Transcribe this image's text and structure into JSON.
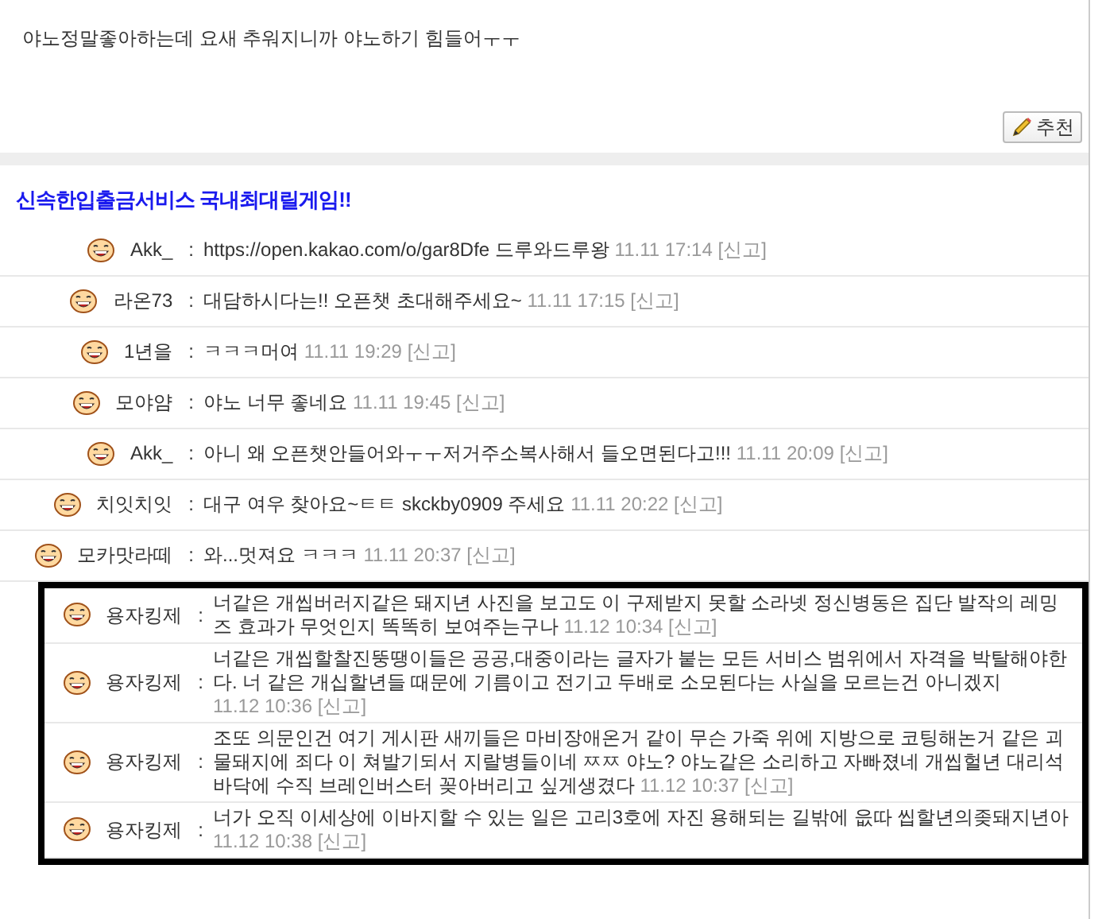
{
  "post": {
    "body": "야노정말좋아하는데 요새 추워지니까 야노하기 힘들어ㅜㅜ",
    "recommend_button": "추천"
  },
  "ad_title": "신속한입출금서비스 국내최대릴게임!!",
  "comments": [
    {
      "author": "Akk_",
      "separator": ":",
      "text": "https://open.kakao.com/o/gar8Dfe 드루와드루왕",
      "time": "11.11 17:14",
      "report": "[신고]",
      "highlighted": false
    },
    {
      "author": "라온73",
      "separator": ":",
      "text": "대담하시다는!! 오픈챗 초대해주세요~",
      "time": "11.11 17:15",
      "report": "[신고]",
      "highlighted": false
    },
    {
      "author": "1년을",
      "separator": ":",
      "text": "ㅋㅋㅋ머여",
      "time": "11.11 19:29",
      "report": "[신고]",
      "highlighted": false
    },
    {
      "author": "모야얌",
      "separator": ":",
      "text": "야노 너무 좋네요",
      "time": "11.11 19:45",
      "report": "[신고]",
      "highlighted": false
    },
    {
      "author": "Akk_",
      "separator": ":",
      "text": "아니 왜 오픈챗안들어와ㅜㅜ저거주소복사해서 들오면된다고!!!",
      "time": "11.11 20:09",
      "report": "[신고]",
      "highlighted": false
    },
    {
      "author": "치잇치잇",
      "separator": ":",
      "text": "대구 여우 찾아요~ㅌㅌ skckby0909 주세요",
      "time": "11.11 20:22",
      "report": "[신고]",
      "highlighted": false
    },
    {
      "author": "모카맛라떼",
      "separator": ":",
      "text": "와...멋져요 ㅋㅋㅋ",
      "time": "11.11 20:37",
      "report": "[신고]",
      "highlighted": false
    },
    {
      "author": "용자킹제",
      "separator": ":",
      "text": "너같은 개씹버러지같은 돼지년 사진을 보고도 이 구제받지 못할 소라넷 정신병동은 집단 발작의 레밍즈 효과가 무엇인지 똑똑히 보여주는구나",
      "time": "11.12 10:34",
      "report": "[신고]",
      "highlighted": true
    },
    {
      "author": "용자킹제",
      "separator": ":",
      "text": "너같은 개씹할찰진뚱땡이들은 공공,대중이라는 글자가 붙는 모든 서비스 범위에서 자격을 박탈해야한다. 너 같은 개십할년들 때문에 기름이고 전기고 두배로 소모된다는 사실을 모르는건 아니겠지",
      "time": "11.12 10:36",
      "report": "[신고]",
      "highlighted": true
    },
    {
      "author": "용자킹제",
      "separator": ":",
      "text": "조또 의문인건 여기 게시판 새끼들은 마비장애온거 같이 무슨 가죽 위에 지방으로 코팅해논거 같은 괴물돼지에 죄다 이 쳐발기되서 지랄병들이네 ㅉㅉ 야노? 야노같은 소리하고 자빠졌네 개씹헐년 대리석 바닥에 수직 브레인버스터 꽂아버리고 싶게생겼다",
      "time": "11.12 10:37",
      "report": "[신고]",
      "highlighted": true
    },
    {
      "author": "용자킹제",
      "separator": ":",
      "text": "너가 오직 이세상에 이바지할 수 있는 일은 고리3호에 자진 용해되는 길밖에 읎따 씹할년의좆돼지년아",
      "time": "11.12 10:38",
      "report": "[신고]",
      "highlighted": true
    }
  ]
}
